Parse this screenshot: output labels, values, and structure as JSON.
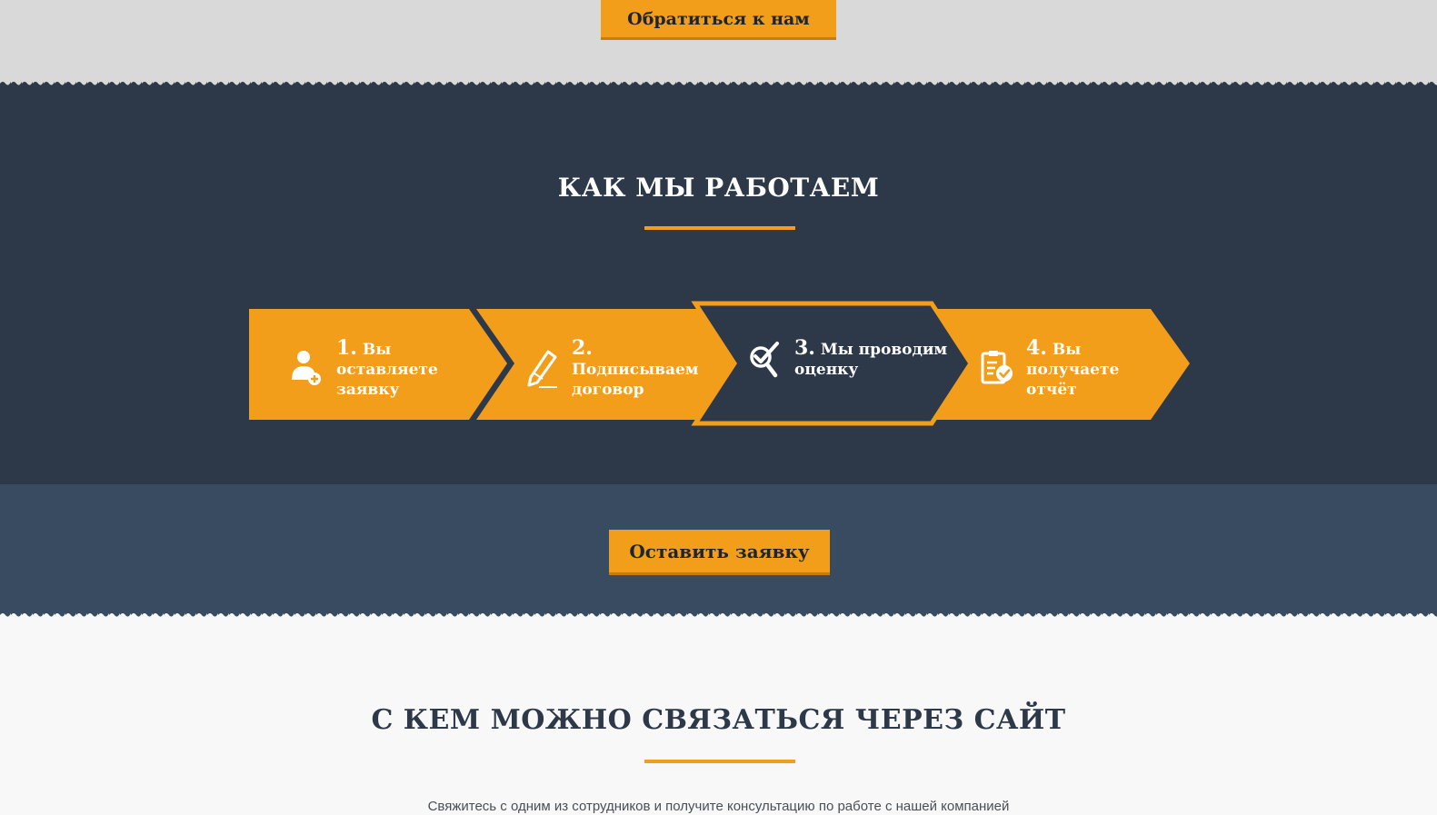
{
  "top_band": {
    "contact_button": "Обратиться к нам"
  },
  "how_we_work": {
    "title": "КАК МЫ РАБОТАЕМ",
    "steps": [
      {
        "num": "1.",
        "text_line1": "Вы оставляете",
        "text_line2": "заявку",
        "icon": "add-user-icon",
        "active": false
      },
      {
        "num": "2.",
        "text_line1": "Подписываем",
        "text_line2": "договор",
        "icon": "pencil-icon",
        "active": false
      },
      {
        "num": "3.",
        "text_line1": "Мы проводим",
        "text_line2": "оценку",
        "icon": "search-check-icon",
        "active": true
      },
      {
        "num": "4.",
        "text_line1": "Вы получаете",
        "text_line2": "отчёт",
        "icon": "clipboard-check-icon",
        "active": false
      }
    ]
  },
  "apply_band": {
    "apply_button": "Оставить заявку"
  },
  "contact_section": {
    "title": "С КЕМ МОЖНО СВЯЗАТЬСЯ ЧЕРЕЗ САЙТ",
    "subtitle": "Свяжитесь с одним из сотрудников и получите консультацию по работе с нашей компанией"
  },
  "colors": {
    "accent": "#f29e1b",
    "dark": "#2d3849",
    "mid": "#394b61",
    "light_grey": "#d9d9d9"
  }
}
